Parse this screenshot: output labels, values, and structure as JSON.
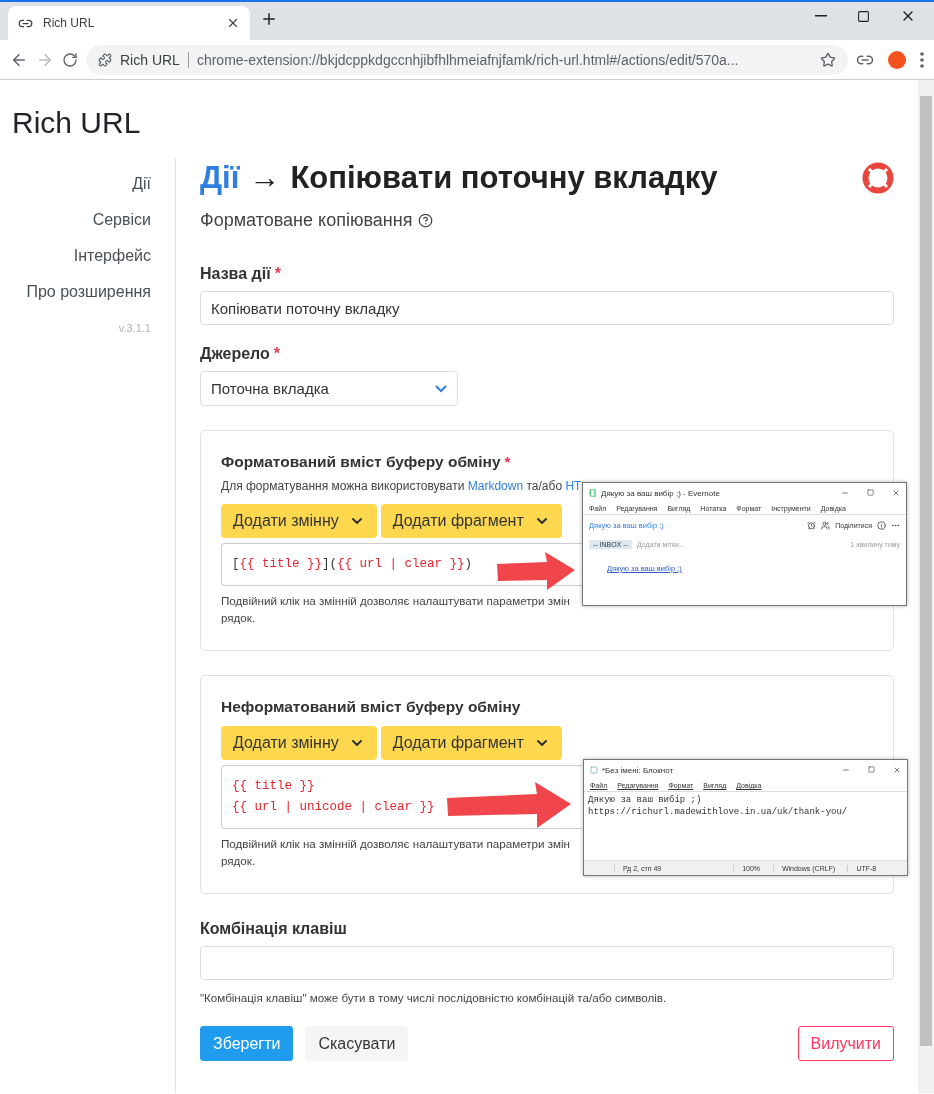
{
  "browser": {
    "tab_title": "Rich URL",
    "chip": "Rich URL",
    "url": "chrome-extension://bkjdcppkdgccnhjibfhlhmeiafnjfamk/rich-url.html#/actions/edit/570a..."
  },
  "app_title": "Rich URL",
  "sidebar": {
    "items": [
      {
        "label": "Дії"
      },
      {
        "label": "Сервіси"
      },
      {
        "label": "Інтерфейс"
      },
      {
        "label": "Про розширення"
      }
    ],
    "version": "v.3.1.1"
  },
  "header": {
    "breadcrumb": "Дії",
    "arrow": "→",
    "title": "Копіювати поточну вкладку",
    "subtitle": "Форматоване копіювання"
  },
  "name_field": {
    "label": "Назва дії",
    "required_mark": "*",
    "value": "Копіювати поточну вкладку"
  },
  "source_field": {
    "label": "Джерело",
    "required_mark": "*",
    "value": "Поточна вкладка"
  },
  "cards": [
    {
      "title": "Форматований вміст буферу обміну",
      "required_mark": "*",
      "hint": [
        {
          "kind": "text",
          "text": "Для форматування можна використовувати "
        },
        {
          "kind": "link",
          "text": "Markdown"
        },
        {
          "kind": "text",
          "text": " та/або "
        },
        {
          "kind": "link",
          "text": "HT"
        }
      ],
      "buttons": [
        "Додати змінну",
        "Додати фрагмент"
      ],
      "code_lines": [
        [
          {
            "kind": "plain",
            "text": "["
          },
          {
            "kind": "variable",
            "text": "{{ title }}"
          },
          {
            "kind": "plain",
            "text": "]("
          },
          {
            "kind": "variable",
            "text": "{{ url | clear }}"
          },
          {
            "kind": "plain",
            "text": ")"
          }
        ]
      ],
      "help_lines": [
        "Подвійний клік на змінній дозволяє налаштувати параметри змін",
        "рядок."
      ]
    },
    {
      "title": "Неформатований вміст буферу обміну",
      "buttons": [
        "Додати змінну",
        "Додати фрагмент"
      ],
      "code_lines": [
        [
          {
            "kind": "variable",
            "text": "{{ title }}"
          }
        ],
        [
          {
            "kind": "variable",
            "text": "{{ url | unicode | clear }}"
          }
        ]
      ],
      "help_lines": [
        "Подвійний клік на змінній дозволяє налаштувати параметри змін",
        "рядок."
      ]
    }
  ],
  "shortcut_field": {
    "label": "Комбінація клавіш",
    "hint": "\"Комбінація клавіш\" може бути в тому числі послідовністю комбінацій та/або символів."
  },
  "actions": [
    {
      "kind": "primary",
      "label": "Зберегти"
    },
    {
      "kind": "secondary",
      "label": "Скасувати"
    },
    {
      "kind": "danger",
      "label": "Вилучити"
    }
  ],
  "evernote": {
    "title": "Дякую за ваш вибір ;) - Evernote",
    "menu": [
      "Файл",
      "Редагування",
      "Вигляд",
      "Нотатка",
      "Формат",
      "Інструменти",
      "Довідка"
    ],
    "note_title": "Дякую за ваш вибір ;)",
    "share": "Поділитися",
    "notebook": "-- INBOX --",
    "tags_placeholder": "Додати мітки...",
    "time": "1 хвилину тому",
    "link": "Дякую за ваш вибір ;)"
  },
  "notepad": {
    "title": "*Без імені: Блокнот",
    "menu": [
      "Файл",
      "Редагування",
      "Формат",
      "Вигляд",
      "Довідка"
    ],
    "lines": [
      "Дякую за ваш вибір ;)",
      "https://richurl.madewithlove.in.ua/uk/thank-you/"
    ],
    "status": [
      "Рд 2, стп 49",
      "100%",
      "Windows (CRLF)",
      "UTF-8"
    ]
  }
}
